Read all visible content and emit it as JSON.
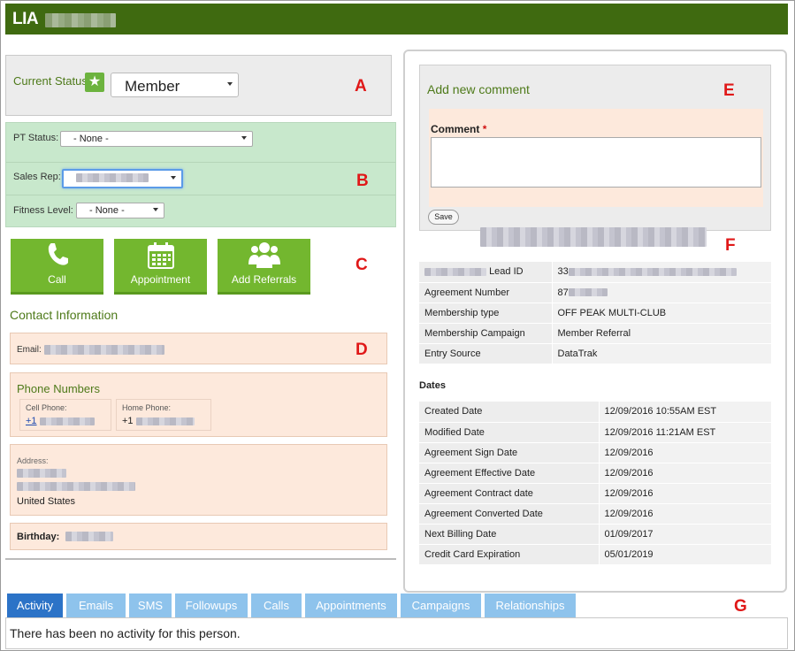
{
  "header": {
    "title": "LIA"
  },
  "markers": {
    "a": "A",
    "b": "B",
    "c": "C",
    "d": "D",
    "e": "E",
    "f": "F",
    "g": "G"
  },
  "status": {
    "label": "Current Status",
    "value": "Member"
  },
  "pt_status": {
    "label": "PT Status:",
    "value": "- None -"
  },
  "sales_rep": {
    "label": "Sales Rep:"
  },
  "fitness_level": {
    "label": "Fitness Level:",
    "value": "- None -"
  },
  "actions": [
    {
      "label": "Call"
    },
    {
      "label": "Appointment"
    },
    {
      "label": "Add Referrals"
    }
  ],
  "contact": {
    "heading": "Contact Information",
    "email_label": "Email:",
    "phones_heading": "Phone Numbers",
    "cell_label": "Cell Phone:",
    "cell_prefix": "+1",
    "home_label": "Home Phone:",
    "home_prefix": "+1",
    "address_label": "Address:",
    "country": "United States",
    "birthday_label": "Birthday:"
  },
  "comment": {
    "heading": "Add new comment",
    "label": "Comment",
    "required_mark": "*",
    "save_label": "Save"
  },
  "lead_info": [
    {
      "k": "Lead ID",
      "v": "33"
    },
    {
      "k": "Agreement Number",
      "v": "87"
    },
    {
      "k": "Membership type",
      "v": "OFF PEAK MULTI-CLUB"
    },
    {
      "k": "Membership Campaign",
      "v": "Member Referral"
    },
    {
      "k": "Entry Source",
      "v": "DataTrak"
    }
  ],
  "dates": {
    "heading": "Dates",
    "rows": [
      {
        "k": "Created Date",
        "v": "12/09/2016 10:55AM EST"
      },
      {
        "k": "Modified Date",
        "v": "12/09/2016 11:21AM EST"
      },
      {
        "k": "Agreement Sign Date",
        "v": "12/09/2016"
      },
      {
        "k": "Agreement Effective Date",
        "v": "12/09/2016"
      },
      {
        "k": "Agreement Contract date",
        "v": "12/09/2016"
      },
      {
        "k": "Agreement Converted Date",
        "v": "12/09/2016"
      },
      {
        "k": "Next Billing Date",
        "v": "01/09/2017"
      },
      {
        "k": "Credit Card Expiration",
        "v": "05/01/2019"
      }
    ]
  },
  "tabs": [
    {
      "label": "Activity"
    },
    {
      "label": "Emails"
    },
    {
      "label": "SMS"
    },
    {
      "label": "Followups"
    },
    {
      "label": "Calls"
    },
    {
      "label": "Appointments"
    },
    {
      "label": "Campaigns"
    },
    {
      "label": "Relationships"
    }
  ],
  "activity_message": "There has been no activity for this person."
}
